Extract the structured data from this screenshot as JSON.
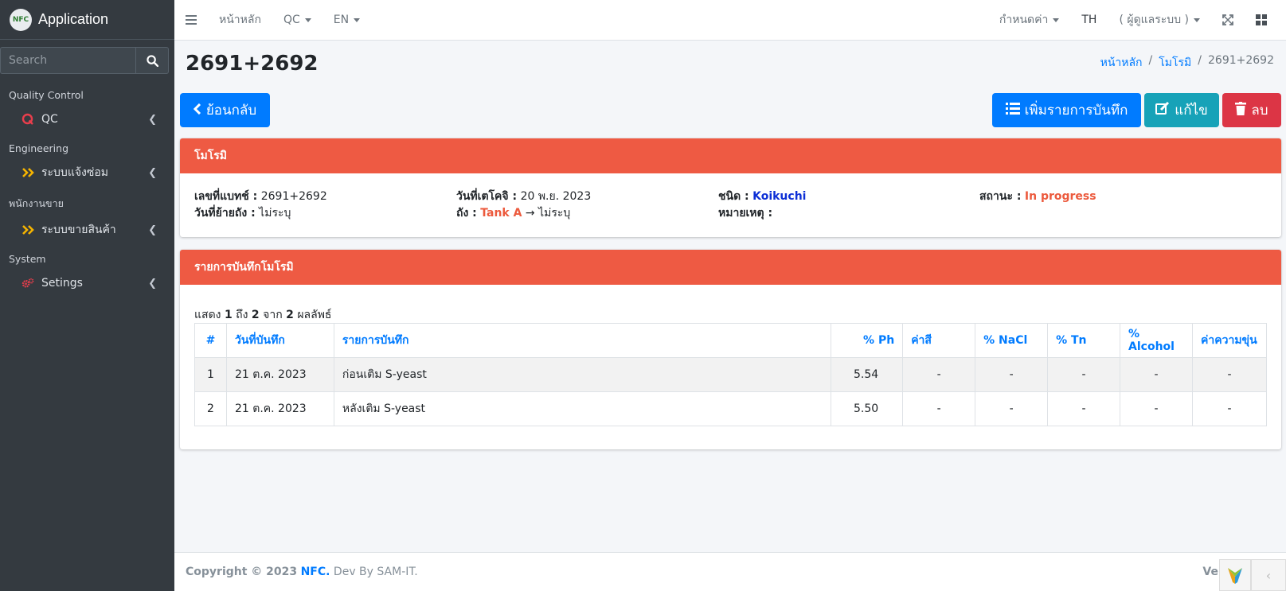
{
  "app": {
    "title": "Application",
    "logo_text": "NFC"
  },
  "search": {
    "placeholder": "Search"
  },
  "sidebar": {
    "sections": [
      {
        "header": "Quality Control",
        "item": "QC",
        "icon": "q-icon"
      },
      {
        "header": "Engineering",
        "item": "ระบบแจ้งซ่อม",
        "icon": "double-chevron-icon"
      },
      {
        "header": "พนักงานขาย",
        "item": "ระบบขายสินค้า",
        "icon": "double-chevron-icon"
      },
      {
        "header": "System",
        "item": "Setings",
        "icon": "gears-icon"
      }
    ]
  },
  "topbar": {
    "home": "หน้าหลัก",
    "qc": "QC",
    "lang": "EN",
    "settings": "กำหนดค่า",
    "th": "TH",
    "user": "( ผู้ดูแลระบบ )"
  },
  "page": {
    "title": "2691+2692",
    "breadcrumb": [
      "หน้าหลัก",
      "โมโรมิ",
      "2691+2692"
    ]
  },
  "buttons": {
    "back": "ย้อนกลับ",
    "add": "เพิ่มรายการบันทึก",
    "edit": "แก้ไข",
    "delete": "ลบ"
  },
  "card_info": {
    "title": "โมโรมิ",
    "batch_label": "เลขที่แบทช์ :",
    "batch_value": "2691+2692",
    "move_label": "วันที่ย้ายถัง :",
    "move_value": "ไม่ระบุ",
    "date_label": "วันที่เตโคจิ :",
    "date_value": "20 พ.ย. 2023",
    "tank_label": "ถัง :",
    "tank_from": "Tank A",
    "tank_arrow": "→",
    "tank_to": "ไม่ระบุ",
    "type_label": "ชนิด :",
    "type_value": "Koikuchi",
    "note_label": "หมายเหตุ :",
    "status_label": "สถานะ :",
    "status_value": "In progress"
  },
  "card_records": {
    "title": "รายการบันทึกโมโรมิ",
    "summary": {
      "prefix": "แสดง",
      "from": "1",
      "to_word": "ถึง",
      "to": "2",
      "of_word": "จาก",
      "total": "2",
      "suffix": "ผลลัพธ์"
    },
    "columns": [
      "#",
      "วันที่บันทึก",
      "รายการบันทึก",
      "% Ph",
      "ค่าสี",
      "% NaCl",
      "% Tn",
      "% Alcohol",
      "ค่าความขุ่น"
    ],
    "rows": [
      [
        "1",
        "21 ต.ค. 2023",
        "ก่อนเติม S-yeast",
        "5.54",
        "-",
        "-",
        "-",
        "-",
        "-"
      ],
      [
        "2",
        "21 ต.ค. 2023",
        "หลังเติม S-yeast",
        "5.50",
        "-",
        "-",
        "-",
        "-",
        "-"
      ]
    ]
  },
  "footer": {
    "copyright": "Copyright © 2023",
    "brand": "NFC.",
    "dev": "Dev By SAM-IT.",
    "version": "Ve"
  },
  "colors": {
    "sidebar_bg": "#343a40",
    "card_header": "#ee5a43",
    "primary": "#007bff",
    "info": "#17a2b8",
    "danger": "#dc3545"
  }
}
